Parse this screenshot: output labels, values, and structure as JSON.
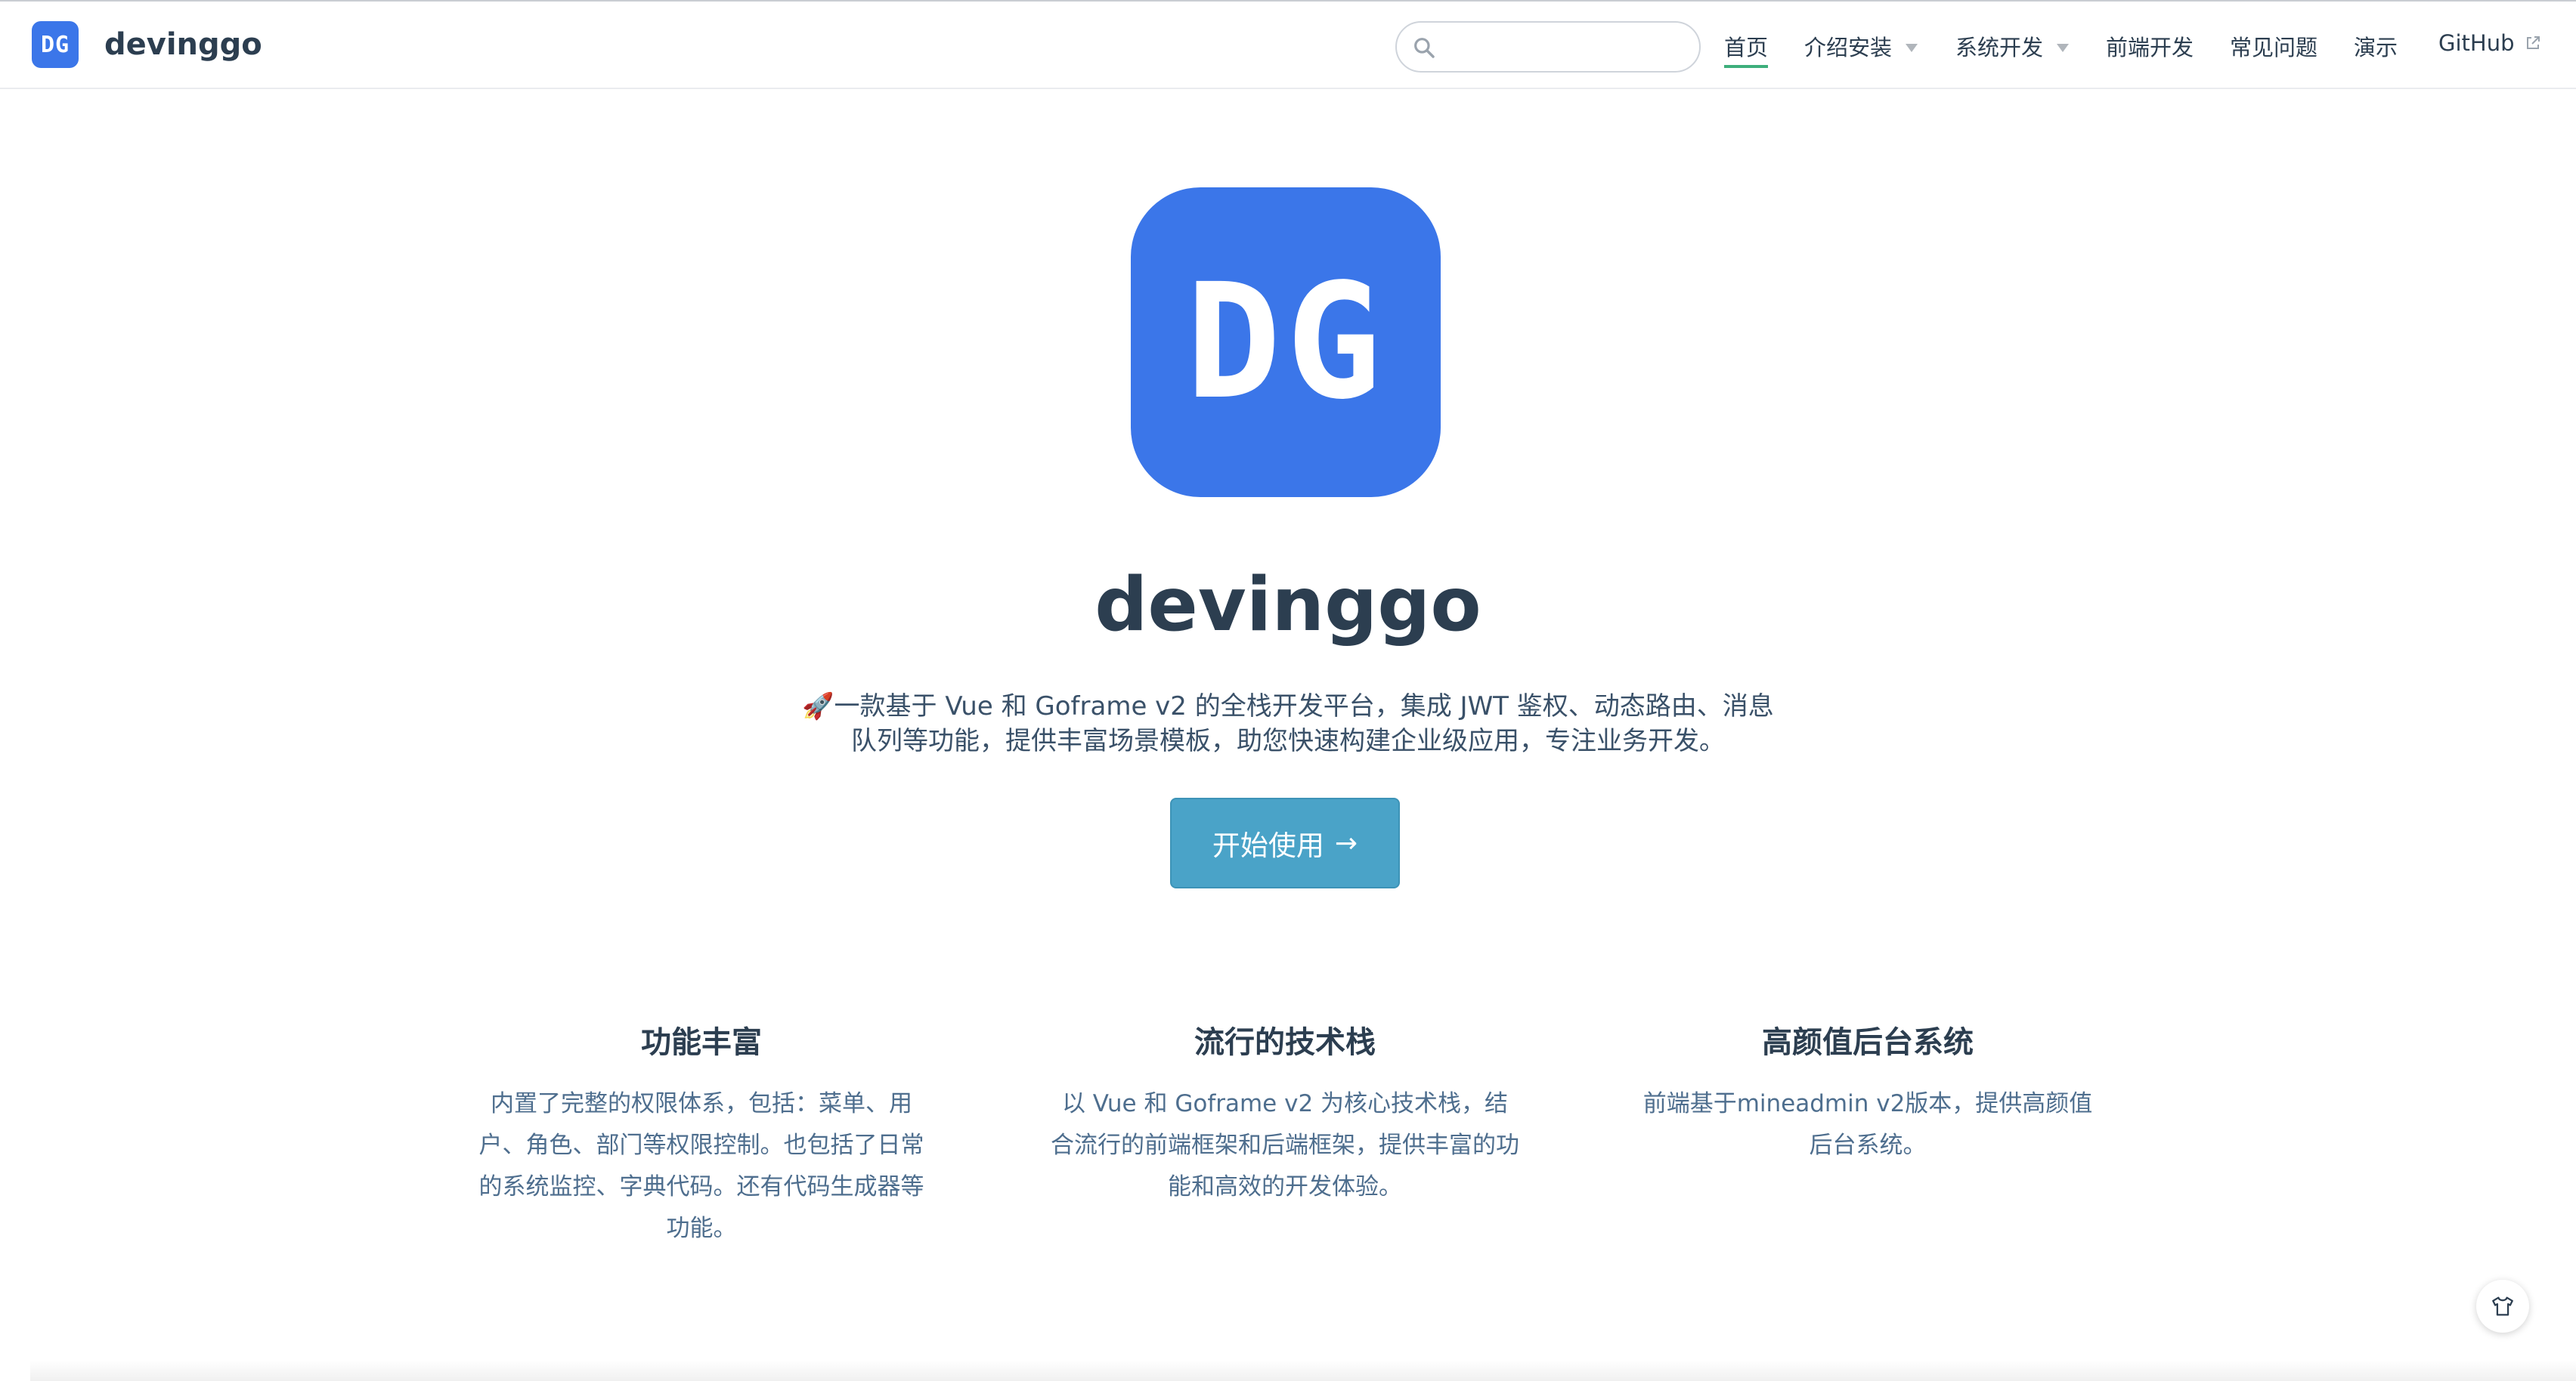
{
  "brand": {
    "logo_text": "DG",
    "name": "devinggo"
  },
  "search": {
    "placeholder": "",
    "value": ""
  },
  "nav": {
    "items": [
      {
        "label": "首页",
        "active": true
      },
      {
        "label": "介绍安装",
        "dropdown": true
      },
      {
        "label": "系统开发",
        "dropdown": true
      },
      {
        "label": "前端开发"
      },
      {
        "label": "常见问题"
      },
      {
        "label": "演示"
      },
      {
        "label": "GitHub",
        "external": true
      }
    ]
  },
  "hero": {
    "logo_text": "DG",
    "title": "devinggo",
    "description": "🚀一款基于 Vue 和 Goframe v2 的全栈开发平台，集成 JWT 鉴权、动态路由、消息队列等功能，提供丰富场景模板，助您快速构建企业级应用，专注业务开发。",
    "action_label": "开始使用",
    "action_arrow": "→"
  },
  "features": [
    {
      "title": "功能丰富",
      "details": "内置了完整的权限体系，包括：菜单、用户、角色、部门等权限控制。也包括了日常的系统监控、字典代码。还有代码生成器等功能。"
    },
    {
      "title": "流行的技术栈",
      "details": "以 Vue 和 Goframe v2 为核心技术栈，结合流行的前端框架和后端框架，提供丰富的功能和高效的开发体验。"
    },
    {
      "title": "高颜值后台系统",
      "details": "前端基于mineadmin v2版本，提供高颜值后台系统。"
    }
  ],
  "colors": {
    "brand_blue": "#3b76e9",
    "action_button": "#4aa3c8",
    "active_underline": "#3eaf7c",
    "text": "#2c3e50"
  },
  "icons": {
    "search": "search-icon",
    "external": "external-link-icon",
    "float": "shirt-icon"
  }
}
